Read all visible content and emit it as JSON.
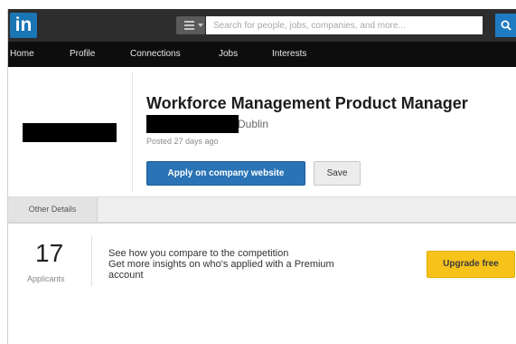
{
  "header": {
    "logo_text": "in",
    "menu_icon": "hamburger-menu-icon",
    "search_placeholder": "Search for people, jobs, companies, and more...",
    "search_icon": "search-icon",
    "brand_color": "#1a76b5"
  },
  "nav": {
    "items": [
      {
        "label": "Home"
      },
      {
        "label": "Profile"
      },
      {
        "label": "Connections"
      },
      {
        "label": "Jobs"
      },
      {
        "label": "Interests"
      }
    ]
  },
  "job": {
    "title": "Workforce Management Product Manager",
    "location": "Dublin",
    "posted": "Posted 27 days ago",
    "apply_label": "Apply on company website",
    "save_label": "Save"
  },
  "tabs": {
    "other_details": "Other Details"
  },
  "stats": {
    "applicants_count": "17",
    "applicants_label": "Applicants"
  },
  "premium": {
    "line1": "See how you compare to the competition",
    "line2": "Get more insights on who's applied with a Premium",
    "line3": "account",
    "upgrade_label": "Upgrade free",
    "upgrade_color": "#f7c31b"
  }
}
